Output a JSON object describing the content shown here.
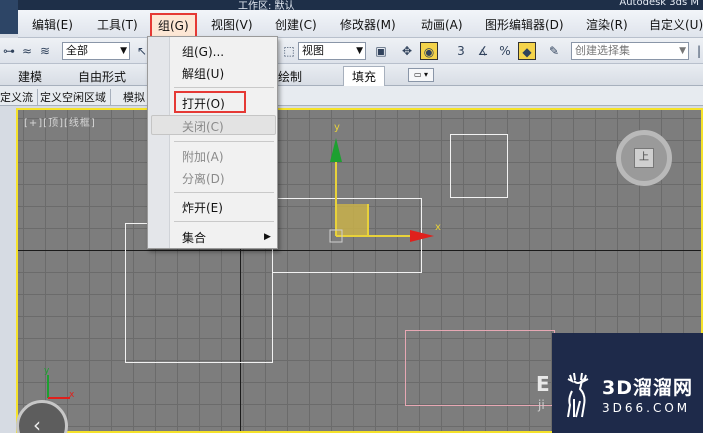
{
  "title_bar": {
    "app_title": "Autodesk 3ds M",
    "workspace": "工作区: 默认"
  },
  "menubar": {
    "items": [
      {
        "label": "编辑(E)"
      },
      {
        "label": "工具(T)"
      },
      {
        "label": "组(G)"
      },
      {
        "label": "视图(V)"
      },
      {
        "label": "创建(C)"
      },
      {
        "label": "修改器(M)"
      },
      {
        "label": "动画(A)"
      },
      {
        "label": "图形编辑器(D)"
      },
      {
        "label": "渲染(R)"
      },
      {
        "label": "自定义(U)"
      }
    ]
  },
  "toolbar": {
    "selection_filter": "全部",
    "reference_coord": "视图",
    "named_selection_placeholder": "创建选择集"
  },
  "ribbon": {
    "tabs": [
      {
        "label": "建模"
      },
      {
        "label": "自由形式"
      },
      {
        "label": "绘制"
      },
      {
        "label": "填充"
      }
    ]
  },
  "subtabs": {
    "items": [
      {
        "label": "定义流"
      },
      {
        "label": "定义空闲区域"
      },
      {
        "label": "模拟"
      }
    ]
  },
  "viewport": {
    "label": "[+][顶][线框]",
    "axis_x": "x",
    "axis_y": "y",
    "mini_axis_x": "x",
    "mini_axis_y": "y",
    "viewcube_face": "上"
  },
  "group_menu": {
    "items": [
      {
        "label": "组(G)...",
        "enabled": true
      },
      {
        "label": "解组(U)",
        "enabled": true
      },
      {
        "label": "打开(O)",
        "enabled": true
      },
      {
        "label": "关闭(C)",
        "enabled": false
      },
      {
        "label": "附加(A)",
        "enabled": false
      },
      {
        "label": "分离(D)",
        "enabled": false
      },
      {
        "label": "炸开(E)",
        "enabled": true
      },
      {
        "label": "集合",
        "enabled": true
      }
    ]
  },
  "watermark": {
    "text": "3D溜溜网",
    "url": "3D66.COM"
  },
  "colors": {
    "highlight_red": "#e53935",
    "viewport_border": "#f5e22a",
    "viewport_bg": "#7d7d7d"
  }
}
